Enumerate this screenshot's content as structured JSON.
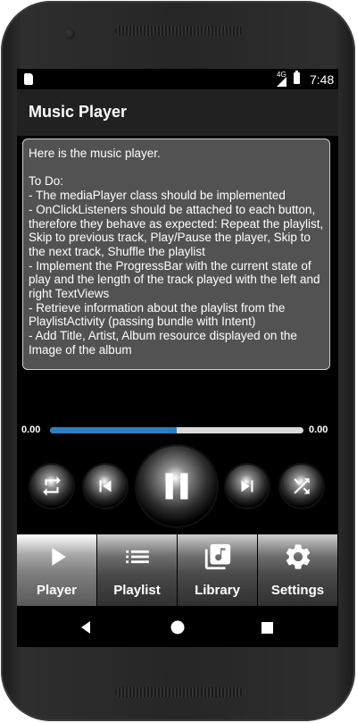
{
  "status_bar": {
    "network": "4G",
    "time": "7:48"
  },
  "app_bar": {
    "title": "Music Player"
  },
  "description": "Here is the music player.\n\nTo Do:\n- The mediaPlayer class should be implemented\n- OnClickListeners should be attached to each button, therefore they behave as expected: Repeat the playlist, Skip to previous track, Play/Pause the player, Skip to the next track, Shuffle the playlist\n- Implement the ProgressBar with the current state of play and the length of the track played with the left and right TextViews\n- Retrieve information about the playlist from the PlaylistActivity (passing bundle with Intent)\n- Add Title, Artist, Album resource displayed on the Image of the album",
  "progress": {
    "current_time": "0.00",
    "total_time": "0.00",
    "fraction": 0.5,
    "fill_color": "#2a7fc1"
  },
  "controls": [
    {
      "name": "repeat",
      "icon": "repeat-icon"
    },
    {
      "name": "previous",
      "icon": "skip-previous-icon"
    },
    {
      "name": "play-pause",
      "icon": "pause-icon"
    },
    {
      "name": "next",
      "icon": "skip-next-icon"
    },
    {
      "name": "shuffle",
      "icon": "shuffle-icon"
    }
  ],
  "tabs": [
    {
      "label": "Player",
      "icon": "play-icon",
      "active": true
    },
    {
      "label": "Playlist",
      "icon": "list-icon",
      "active": false
    },
    {
      "label": "Library",
      "icon": "library-music-icon",
      "active": false
    },
    {
      "label": "Settings",
      "icon": "gear-icon",
      "active": false
    }
  ],
  "nav": {
    "back": "back-icon",
    "home": "home-icon",
    "recents": "recents-icon"
  }
}
